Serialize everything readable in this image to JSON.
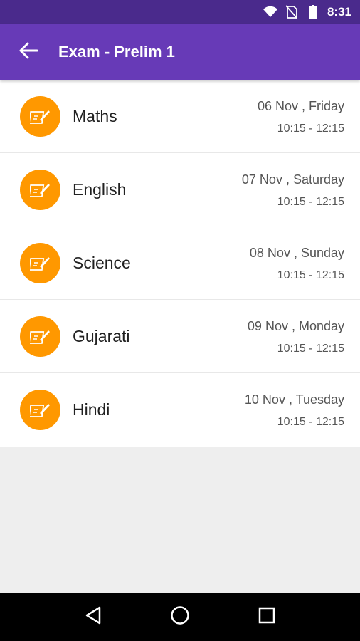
{
  "status_bar": {
    "time": "8:31"
  },
  "app_bar": {
    "title": "Exam - Prelim 1"
  },
  "exams": [
    {
      "subject": "Maths",
      "date": "06 Nov , Friday",
      "time": "10:15 - 12:15"
    },
    {
      "subject": "English",
      "date": "07 Nov , Saturday",
      "time": "10:15 - 12:15"
    },
    {
      "subject": "Science",
      "date": "08 Nov , Sunday",
      "time": "10:15 - 12:15"
    },
    {
      "subject": "Gujarati",
      "date": "09 Nov , Monday",
      "time": "10:15 - 12:15"
    },
    {
      "subject": "Hindi",
      "date": "10 Nov , Tuesday",
      "time": "10:15 - 12:15"
    }
  ],
  "icons": {
    "back": "arrow-left-icon",
    "exam": "exam-paper-pencil-icon",
    "wifi": "wifi-icon",
    "no_sim": "no-sim-icon",
    "battery": "battery-icon",
    "nav_back": "triangle-back-icon",
    "nav_home": "circle-home-icon",
    "nav_recents": "square-recents-icon"
  },
  "colors": {
    "status_bar": "#4a2a8c",
    "app_bar": "#673ab7",
    "avatar": "#ff9800",
    "background": "#eeeeee"
  }
}
